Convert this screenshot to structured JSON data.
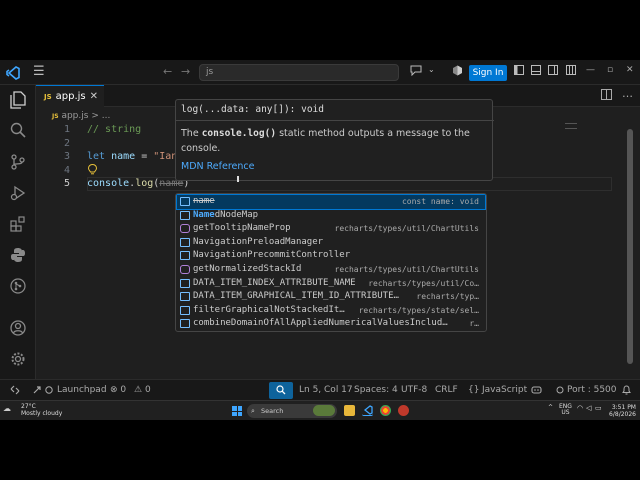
{
  "titlebar": {
    "menu_icon": "hamburger-icon",
    "search_text": "js",
    "signin_label": "Sign In"
  },
  "tabs": [
    {
      "badge": "JS",
      "label": "app.js",
      "close": "✕"
    }
  ],
  "breadcrumb": {
    "badge": "JS",
    "file": "app.js",
    "separator": ">",
    "rest": "..."
  },
  "editor": {
    "lines": [
      {
        "num": "1",
        "text": "// string"
      },
      {
        "num": "2",
        "text": ""
      },
      {
        "num": "3",
        "kw": "let",
        "var": "name",
        "op": " = ",
        "str": "\"Ian\""
      },
      {
        "num": "4",
        "text": ""
      },
      {
        "num": "5",
        "obj": "console",
        "dot": ".",
        "fn": "log",
        "open": "(",
        "hint": "name",
        "close": ")"
      }
    ]
  },
  "hover": {
    "signature": "log(...data: any[]): void",
    "desc_pre": "The ",
    "desc_code": "console.log()",
    "desc_post": " static method outputs a message to the console.",
    "link": "MDN Reference"
  },
  "suggest": [
    {
      "icon": "variable-icon",
      "label": "name",
      "match": "",
      "detail": "const name: void",
      "selected": true,
      "strike": true
    },
    {
      "icon": "variable-icon",
      "label": "NamedNodeMap",
      "match": "Name",
      "detail": "",
      "selected": false
    },
    {
      "icon": "method-icon",
      "label": "getTooltipNameProp",
      "match": "",
      "detail": "recharts/types/util/ChartUtils",
      "selected": false
    },
    {
      "icon": "variable-icon",
      "label": "NavigationPreloadManager",
      "match": "",
      "detail": "",
      "selected": false
    },
    {
      "icon": "variable-icon",
      "label": "NavigationPrecommitController",
      "match": "",
      "detail": "",
      "selected": false
    },
    {
      "icon": "method-icon",
      "label": "getNormalizedStackId",
      "match": "",
      "detail": "recharts/types/util/ChartUtils",
      "selected": false
    },
    {
      "icon": "variable-icon",
      "label": "DATA_ITEM_INDEX_ATTRIBUTE_NAME",
      "match": "",
      "detail": "recharts/types/util/Co…",
      "selected": false
    },
    {
      "icon": "variable-icon",
      "label": "DATA_ITEM_GRAPHICAL_ITEM_ID_ATTRIBUTE…",
      "match": "",
      "detail": "recharts/typ…",
      "selected": false
    },
    {
      "icon": "variable-icon",
      "label": "filterGraphicalNotStackedIt…",
      "match": "",
      "detail": "recharts/types/state/sel…",
      "selected": false
    },
    {
      "icon": "variable-icon",
      "label": "combineDomainOfAllAppliedNumericalValuesInclud…",
      "match": "",
      "detail": "r…",
      "selected": false
    }
  ],
  "status": {
    "launchpad": "Launchpad",
    "errors": "0",
    "warnings": "0",
    "position": "Ln 5, Col 17",
    "spaces": "Spaces: 4",
    "encoding": "UTF-8",
    "eol": "CRLF",
    "language": "JavaScript",
    "port": "Port : 5500"
  },
  "taskbar": {
    "temp": "27°C",
    "weather": "Mostly cloudy",
    "search": "Search",
    "lang1": "ENG",
    "lang2": "US",
    "time": "3:51 PM",
    "date": "6/8/2026"
  },
  "colors": {
    "accent": "#0078d4",
    "editor_bg": "#1f1f1f",
    "keyword": "#569cd6",
    "string": "#ce9178",
    "function": "#dcdcaa",
    "comment": "#6a9955"
  }
}
